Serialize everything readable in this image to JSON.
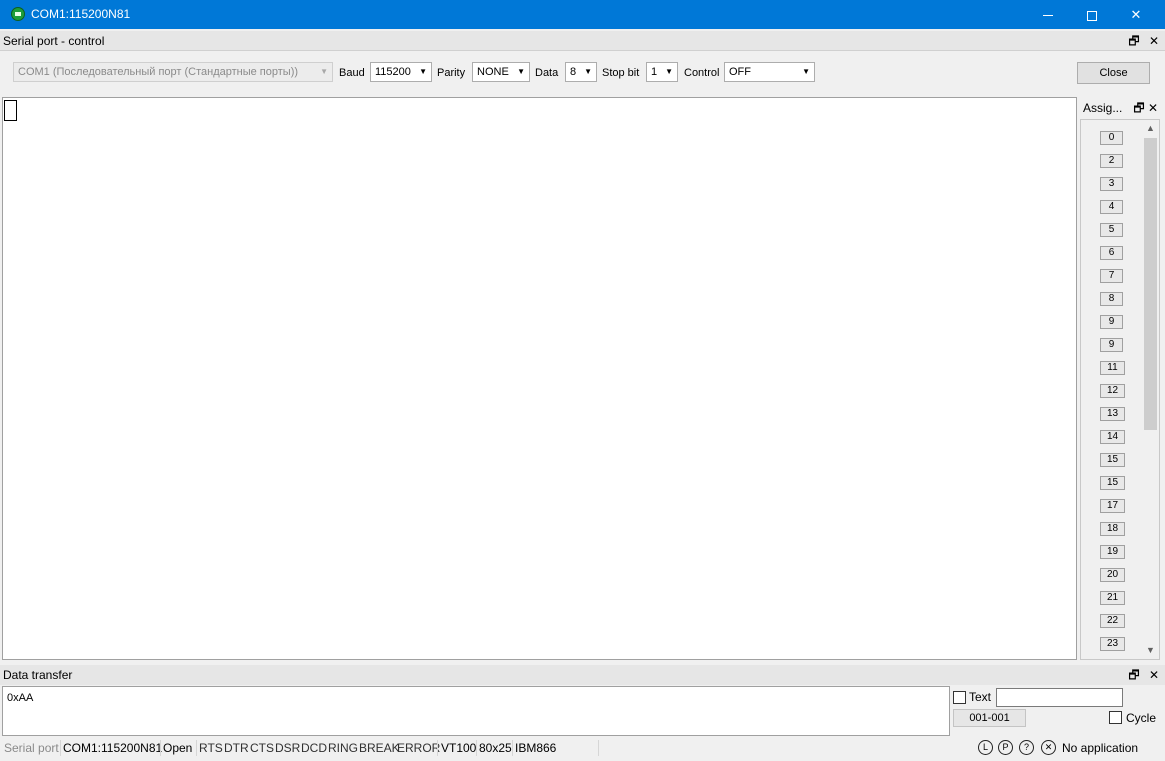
{
  "window": {
    "title": "COM1:115200N81",
    "icon": "serial-terminal-icon",
    "controls": {
      "minimize": "minimize-icon",
      "maximize": "maximize-icon",
      "close": "✕"
    }
  },
  "control_panel": {
    "title": "Serial port - control",
    "port_combo": "COM1  (Последовательный порт (Стандартные порты))",
    "baud_label": "Baud",
    "baud_value": "115200",
    "parity_label": "Parity",
    "parity_value": "NONE",
    "data_label": "Data",
    "data_value": "8",
    "stopbit_label": "Stop bit",
    "stopbit_value": "1",
    "control_label": "Control",
    "control_value": "OFF",
    "close_button": "Close"
  },
  "dock_glyphs": {
    "float": "🗗",
    "close": "✕",
    "arrow": "▼",
    "up": "▲",
    "down": "▼"
  },
  "assign_panel": {
    "title": "Assig...",
    "buttons": [
      "0",
      "2",
      "3",
      "4",
      "5",
      "6",
      "7",
      "8",
      "9",
      "9",
      "11",
      "12",
      "13",
      "14",
      "15",
      "15",
      "17",
      "18",
      "19",
      "20",
      "21",
      "22",
      "23"
    ]
  },
  "data_transfer": {
    "title": "Data transfer",
    "input_value": "0xAA",
    "text_checkbox_label": "Text",
    "text_field_value": "",
    "counter": "001-001",
    "cycle_checkbox_label": "Cycle"
  },
  "statusbar": {
    "serial_port_label": "Serial port",
    "port": "COM1:115200N81",
    "state": "Open",
    "signals": [
      "RTS",
      "DTR",
      "CTS",
      "DSR",
      "DCD",
      "RING",
      "BREAK",
      "ERROR"
    ],
    "emulation": "VT100",
    "size": "80x25",
    "codepage": "IBM866",
    "status_icons": [
      "L",
      "P",
      "?",
      "✕"
    ],
    "application": "No application"
  }
}
